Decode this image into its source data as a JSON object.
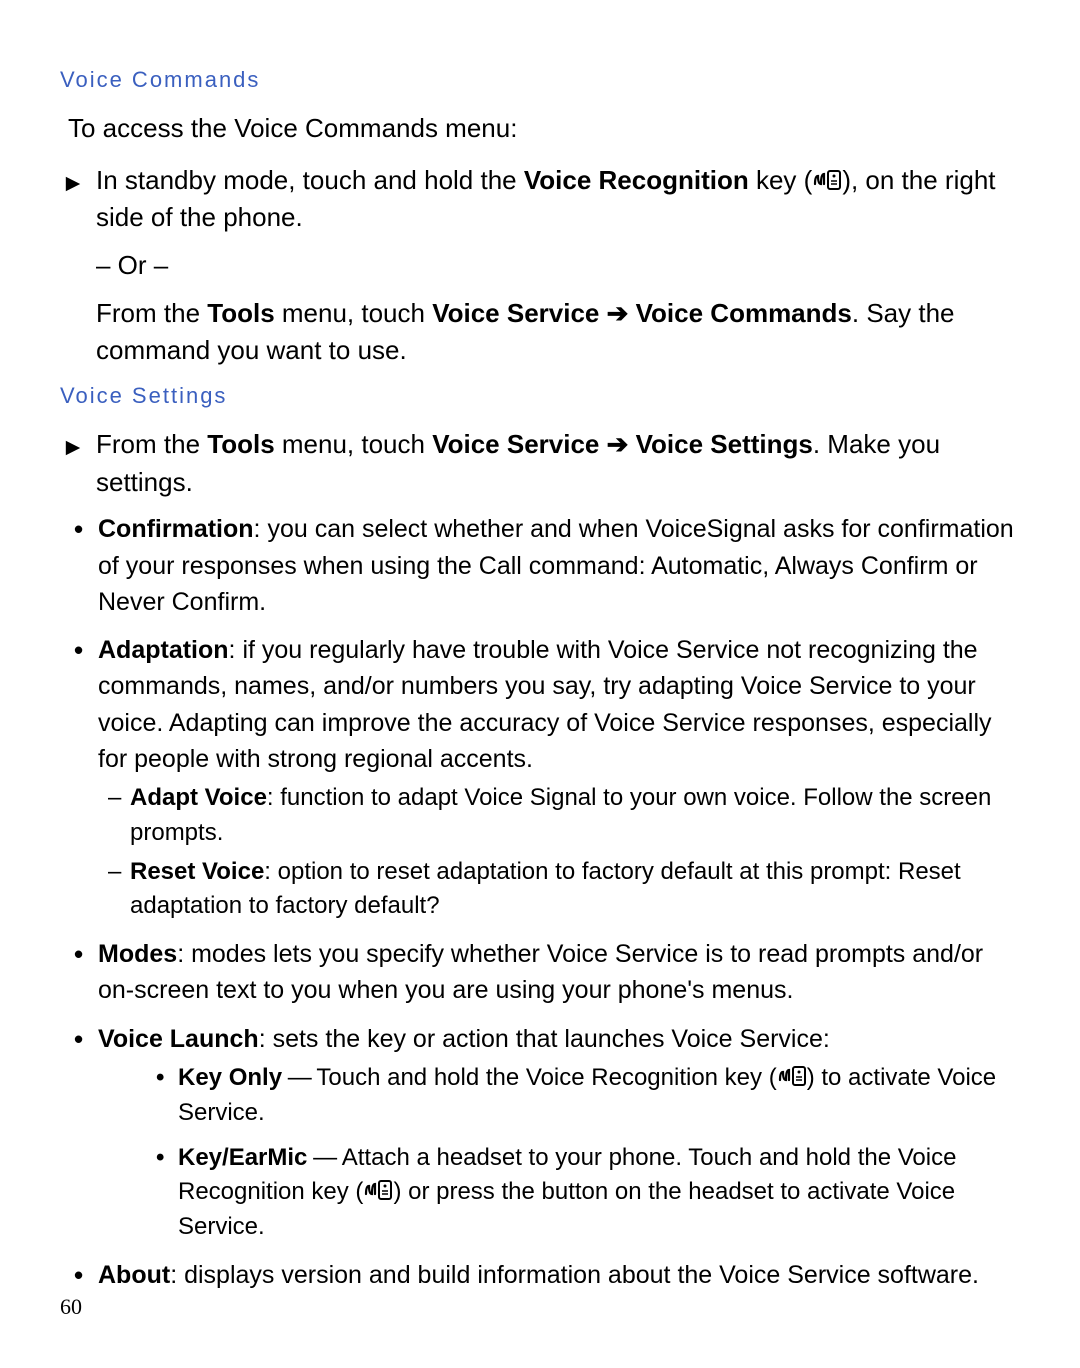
{
  "page_number": "60",
  "icons": {
    "arrow_name": "play-arrow-icon",
    "voice_name": "voice-recognition-icon"
  },
  "voice_commands": {
    "heading": "Voice Commands",
    "intro": "To access the Voice Commands menu:",
    "step1": {
      "pre": "In standby mode, touch and hold the ",
      "bold1": "Voice Recognition",
      "mid": " key (",
      "post": "), on the right side of the phone."
    },
    "or": "– Or –",
    "step1b": {
      "pre": "From the ",
      "b1": "Tools",
      "m1": " menu, touch ",
      "b2": "Voice Service",
      "arrow": " ➔ ",
      "b3": "Voice Commands",
      "post": ". Say the command you want to use."
    }
  },
  "voice_settings": {
    "heading": "Voice Settings",
    "step": {
      "pre": "From the ",
      "b1": "Tools",
      "m1": " menu, touch ",
      "b2": "Voice Service",
      "arrow": " ➔ ",
      "b3": "Voice Settings",
      "post": ". Make you settings."
    },
    "items": {
      "confirmation": {
        "label": "Confirmation",
        "text": ": you can select whether and when VoiceSignal asks for confirmation of your responses when using the Call command: Automatic, Always Confirm or Never Confirm."
      },
      "adaptation": {
        "label": "Adaptation",
        "text": ": if you regularly have trouble with Voice Service not recognizing the commands, names, and/or numbers you say, try adapting Voice Service to your voice. Adapting can improve the accuracy of Voice Service responses, especially for people with strong regional accents.",
        "sub": {
          "adapt": {
            "label": "Adapt Voice",
            "text": ": function to adapt Voice Signal to your own voice. Follow the screen prompts."
          },
          "reset": {
            "label": "Reset Voice",
            "text": ": option to reset adaptation to factory default at this prompt: Reset adaptation to factory default?"
          }
        }
      },
      "modes": {
        "label": "Modes",
        "text": ": modes lets you specify whether Voice Service is to read prompts and/or on-screen text to you when you are using your phone's menus."
      },
      "voice_launch": {
        "label": "Voice Launch",
        "text": ": sets the key or action that launches Voice Service:",
        "sub": {
          "key_only": {
            "label": "Key Only",
            "dash": " — ",
            "pre": "Touch and hold the Voice Recognition key (",
            "post": ") to activate Voice Service."
          },
          "key_earmic": {
            "label": "Key/EarMic",
            "dash": " — ",
            "pre": "Attach a headset to your phone. Touch and hold the Voice Recognition key (",
            "post": ") or press the button on the headset to activate Voice Service."
          }
        }
      },
      "about": {
        "label": "About",
        "text": ": displays version and build information about the Voice Service software."
      }
    }
  }
}
